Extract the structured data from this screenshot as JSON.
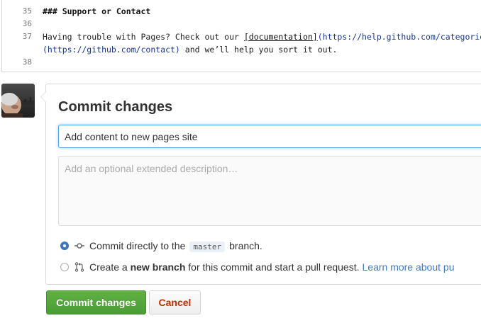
{
  "editor": {
    "lines": [
      {
        "number": "35",
        "heading": "### Support or Contact"
      },
      {
        "number": "36"
      },
      {
        "number": "37",
        "prefix": "Having trouble with Pages? Check out our ",
        "link_text": "[documentation]",
        "link_url": "(https://help.github.com/categories/gi"
      },
      {
        "number": "",
        "url": "(https://github.com/contact)",
        "suffix": " and we’ll help you sort it out."
      },
      {
        "number": "38"
      }
    ]
  },
  "commit": {
    "title": "Commit changes",
    "summary_value": "Add content to new pages site",
    "description_placeholder": "Add an optional extended description…",
    "option_direct": {
      "text_before": "Commit directly to the",
      "branch": "master",
      "text_after": "branch."
    },
    "option_new_branch": {
      "text_before": "Create a",
      "bold": "new branch",
      "text_after": "for this commit and start a pull request.",
      "link": "Learn more about pu"
    }
  },
  "buttons": {
    "commit_label": "Commit changes",
    "cancel_label": "Cancel"
  },
  "colors": {
    "accent_blue": "#4078c0",
    "primary_green": "#55a532",
    "cancel_red": "#bd2c00"
  }
}
